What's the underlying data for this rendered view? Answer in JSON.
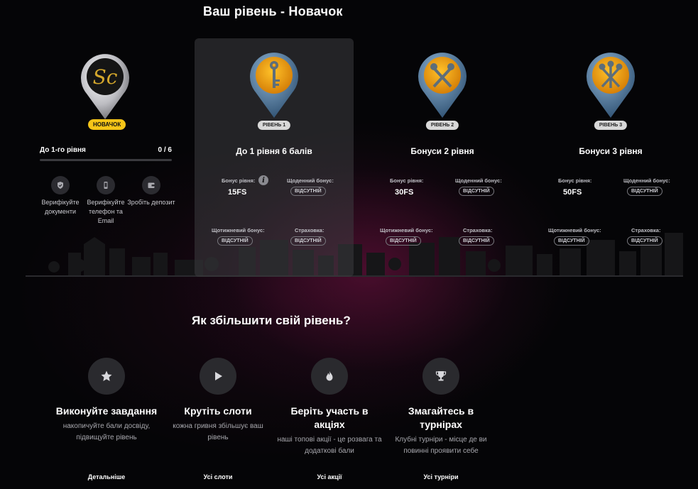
{
  "page_title": "Ваш рівень - Новачок",
  "current": {
    "badge": "НОВАЧОК",
    "progress_label": "До 1-го рівня",
    "progress_count": "0 / 6",
    "progress_value": 0,
    "tasks": [
      {
        "icon": "shield-check-icon",
        "label": "Верифікуйте документи"
      },
      {
        "icon": "phone-icon",
        "label": "Верифікуйте телефон та Email"
      },
      {
        "icon": "wallet-icon",
        "label": "Зробіть депозит"
      }
    ]
  },
  "levels": [
    {
      "badge": "РІВЕНЬ 1",
      "title": "До 1 рівня 6 балів",
      "level_bonus_label": "Бонус рівня:",
      "level_bonus_value": "15FS",
      "daily_label": "Щоденний бонус:",
      "daily_value": "ВІДСУТНІЙ",
      "weekly_label": "Щотижневий бонус:",
      "weekly_value": "ВІДСУТНІЙ",
      "insurance_label": "Страховка:",
      "insurance_value": "ВІДСУТНІЙ"
    },
    {
      "badge": "РІВЕНЬ 2",
      "title": "Бонуси 2 рівня",
      "level_bonus_label": "Бонус рівня:",
      "level_bonus_value": "30FS",
      "daily_label": "Щоденний бонус:",
      "daily_value": "ВІДСУТНІЙ",
      "weekly_label": "Щотижневий бонус:",
      "weekly_value": "ВІДСУТНІЙ",
      "insurance_label": "Страховка:",
      "insurance_value": "ВІДСУТНІЙ"
    },
    {
      "badge": "РІВЕНЬ 3",
      "title": "Бонуси 3 рівня",
      "level_bonus_label": "Бонус рівня:",
      "level_bonus_value": "50FS",
      "daily_label": "Щоденний бонус:",
      "daily_value": "ВІДСУТНІЙ",
      "weekly_label": "Щотижневий бонус:",
      "weekly_value": "ВІДСУТНІЙ",
      "insurance_label": "Страховка:",
      "insurance_value": "ВІДСУТНІЙ"
    }
  ],
  "how_to": {
    "title": "Як збільшити свій рівень?",
    "items": [
      {
        "icon": "star-icon",
        "title": "Виконуйте завдання",
        "desc": "накопичуйте бали досвіду, підвищуйте рівень",
        "link": "Детальніше"
      },
      {
        "icon": "play-icon",
        "title": "Крутіть слоти",
        "desc": "кожна гривня збільшує ваш рівень",
        "link": "Усі слоти"
      },
      {
        "icon": "fire-icon",
        "title": "Беріть участь в акціях",
        "desc": "наші топові акції - це розвага та додаткові бали",
        "link": "Усі акції"
      },
      {
        "icon": "trophy-icon",
        "title": "Змагайтесь в турнірах",
        "desc": "Клубні турніри - місце де ви повинні проявити себе",
        "link": "Усі турніри"
      }
    ]
  },
  "colors": {
    "accent": "#f5c518",
    "background": "#050507"
  }
}
